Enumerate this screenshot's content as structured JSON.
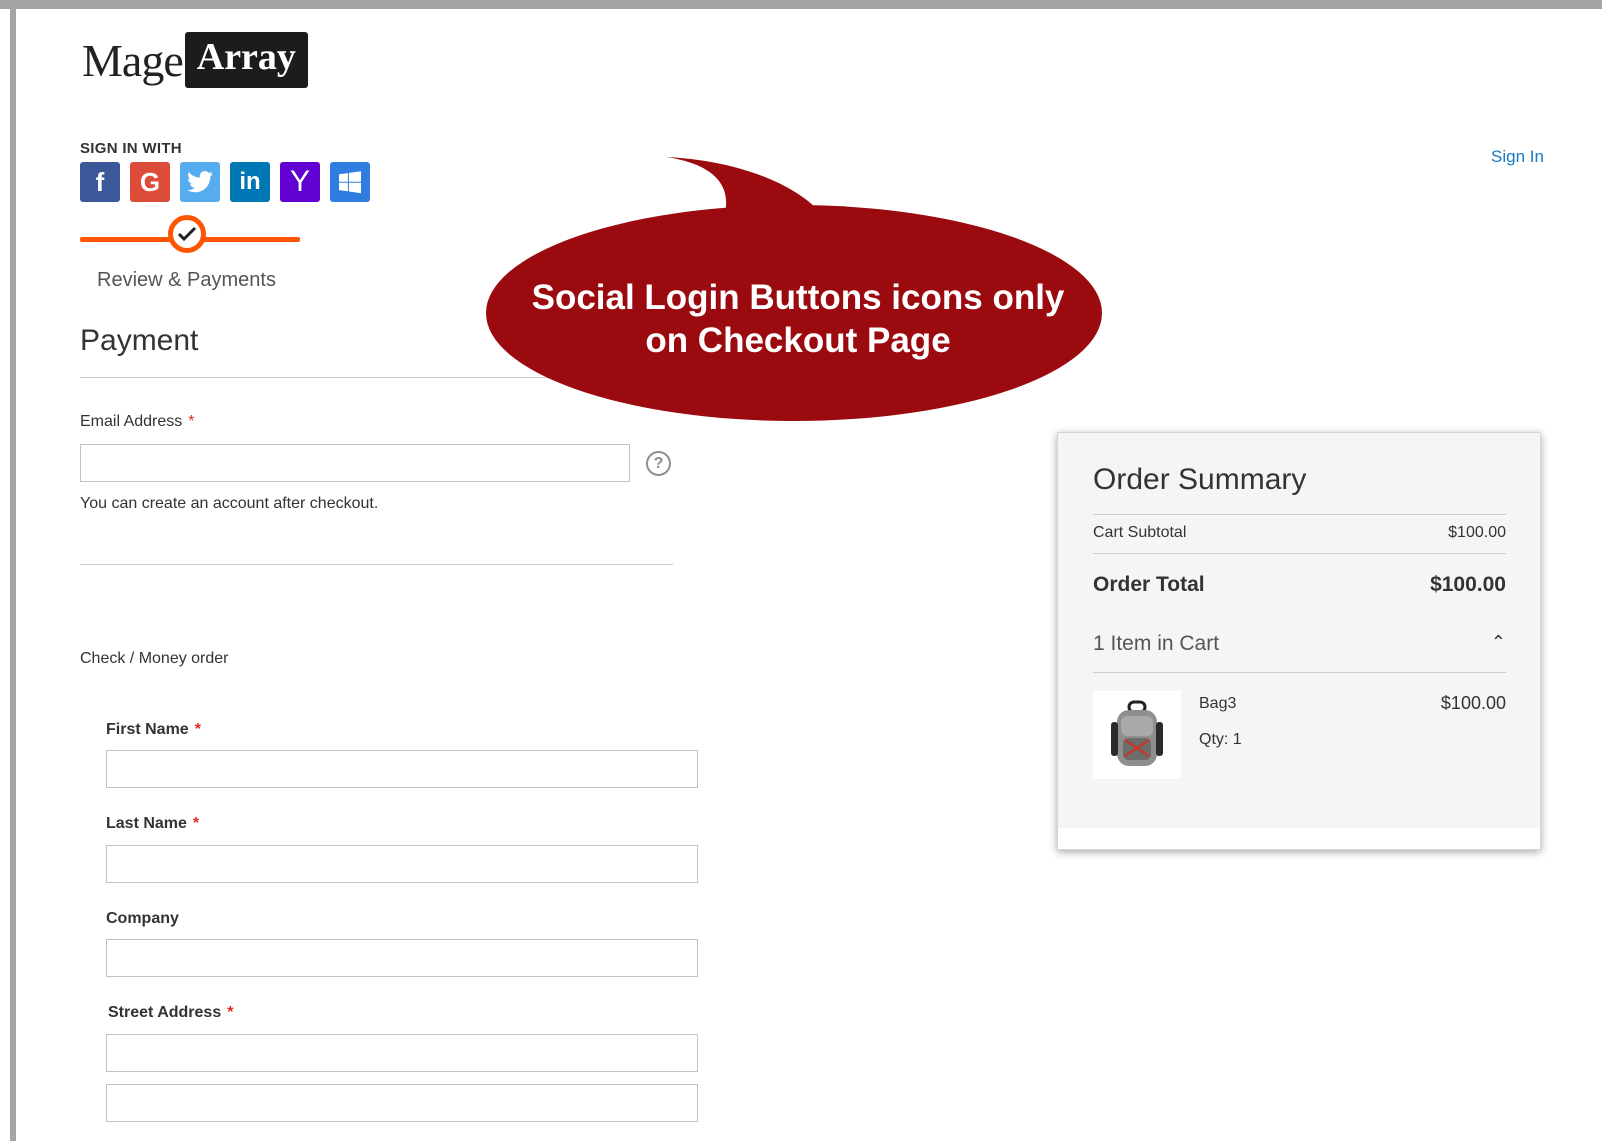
{
  "logo": {
    "part1": "Mage",
    "part2": "Array"
  },
  "header": {
    "sign_in_with": "SIGN IN WITH",
    "sign_in_link": "Sign In"
  },
  "social_buttons": [
    {
      "name": "facebook",
      "glyph": "f",
      "color": "#3b5998"
    },
    {
      "name": "google",
      "glyph": "G",
      "color": "#dd4b39"
    },
    {
      "name": "twitter",
      "glyph": "twitter-bird",
      "color": "#55acee"
    },
    {
      "name": "linkedin",
      "glyph": "in",
      "color": "#0077b5"
    },
    {
      "name": "yahoo",
      "glyph": "Y",
      "color": "#6001d2"
    },
    {
      "name": "microsoft",
      "glyph": "windows-logo",
      "color": "#2f7de1"
    }
  ],
  "progress": {
    "step_label": "Review & Payments",
    "accent": "#ff5501"
  },
  "callout": {
    "line1": "Social Login Buttons icons only",
    "line2": "on Checkout Page",
    "color": "#9b0a0f"
  },
  "payment": {
    "title": "Payment",
    "email_label": "Email Address",
    "email_value": "",
    "note": "You can create an account after checkout.",
    "method": "Check / Money order"
  },
  "form": {
    "first_name_label": "First Name",
    "last_name_label": "Last Name",
    "company_label": "Company",
    "street_label": "Street Address",
    "required_mark": "*"
  },
  "summary": {
    "title": "Order Summary",
    "subtotal_label": "Cart Subtotal",
    "subtotal_value": "$100.00",
    "total_label": "Order Total",
    "total_value": "$100.00",
    "items_label": "1 Item in Cart",
    "item": {
      "name": "Bag3",
      "qty": "Qty: 1",
      "price": "$100.00"
    }
  },
  "icons": {
    "help": "question-circle-icon",
    "chevron": "chevron-up-icon",
    "check": "check-icon"
  }
}
